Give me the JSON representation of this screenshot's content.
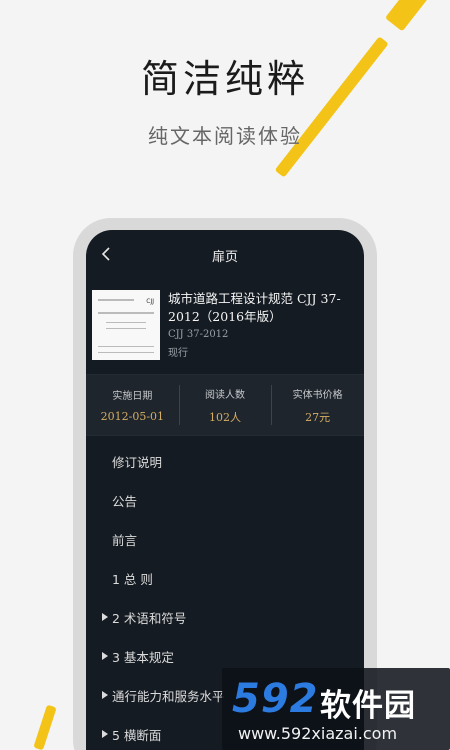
{
  "hero": {
    "title": "简洁纯粹",
    "subtitle": "纯文本阅读体验"
  },
  "nav": {
    "title": "扉页",
    "back_icon": "chevron-left-icon"
  },
  "book": {
    "title": "城市道路工程设计规范 CJJ 37-2012（2016年版）",
    "code": "CJJ 37-2012",
    "status": "现行"
  },
  "stats": [
    {
      "label": "实施日期",
      "value": "2012-05-01"
    },
    {
      "label": "阅读人数",
      "value": "102人"
    },
    {
      "label": "实体书价格",
      "value": "27元"
    }
  ],
  "toc": [
    {
      "label": "修订说明",
      "expandable": false
    },
    {
      "label": "公告",
      "expandable": false
    },
    {
      "label": "前言",
      "expandable": false
    },
    {
      "label": "1 总 则",
      "expandable": false
    },
    {
      "label": "2 术语和符号",
      "expandable": true
    },
    {
      "label": "3 基本规定",
      "expandable": true
    },
    {
      "label": "通行能力和服务水平",
      "expandable": true
    },
    {
      "label": "5 横断面",
      "expandable": true
    }
  ],
  "watermark": {
    "number": "592",
    "brand": "软件园",
    "url": "www.592xiazai.com"
  },
  "colors": {
    "accent_yellow": "#f3c417",
    "screen_bg": "#151b22",
    "stat_value": "#d5ad65",
    "watermark_blue": "#2c7be0"
  }
}
